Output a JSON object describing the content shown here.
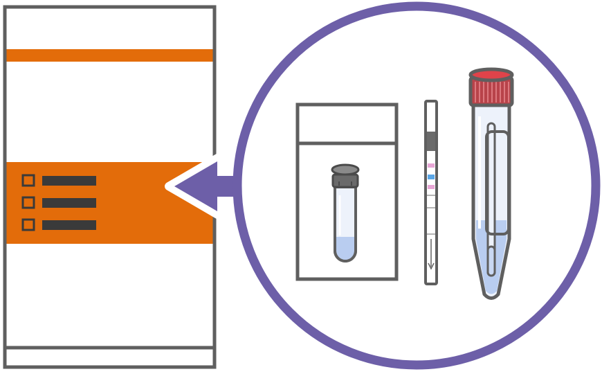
{
  "colors": {
    "outline": "#5f5f5f",
    "kit_band": "#e36c0a",
    "magnifier_ring": "#6d5fa8",
    "arrow": "#6d5fa8",
    "liquid": "#b9cdf0",
    "tube_body": "#edf2fb",
    "cap_red": "#e0434a",
    "cap_dark": "#6a6a6a",
    "strip_pink": "#e8a6d6",
    "strip_blue": "#5aa6e6"
  },
  "icons": {
    "kit_box": "test-kit-box-icon",
    "checklist": "checklist-icon",
    "pointer": "arrow-left-icon",
    "magnifier": "magnifier-circle-icon",
    "pouch": "sealed-pouch-icon",
    "small_tube": "small-tube-icon",
    "strip": "test-strip-icon",
    "large_tube": "conical-collection-tube-icon"
  },
  "checklist": {
    "items": 3
  }
}
